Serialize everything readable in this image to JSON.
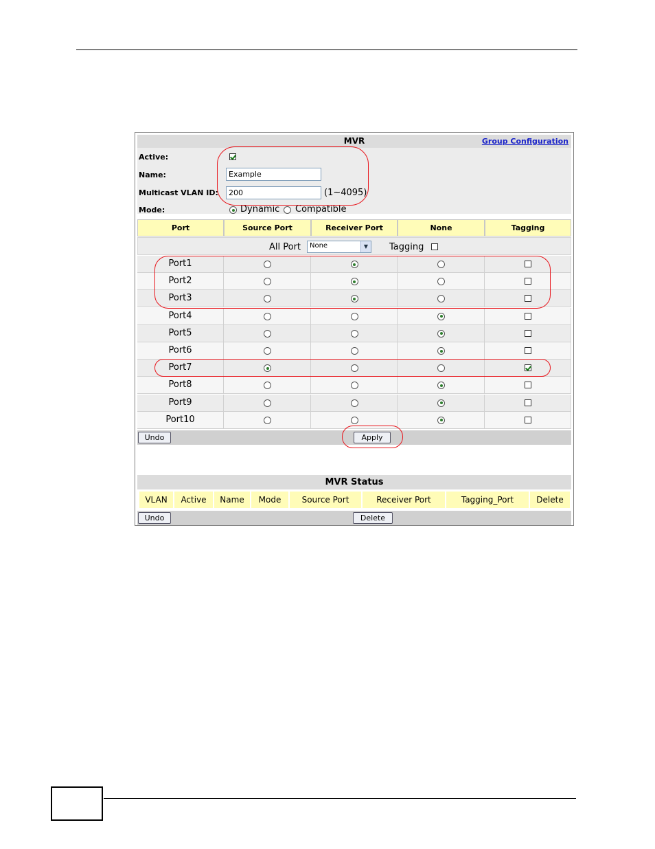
{
  "mvr": {
    "title": "MVR",
    "group_link": "Group Configuration",
    "active_label": "Active:",
    "active_checked": true,
    "name_label": "Name:",
    "name_value": "Example",
    "vlan_label": "Multicast VLAN ID:",
    "vlan_value": "200",
    "vlan_range": "(1~4095)",
    "mode_label": "Mode:",
    "mode_options": [
      "Dynamic",
      "Compatible"
    ],
    "mode_selected": "Dynamic"
  },
  "columns": [
    "Port",
    "Source Port",
    "Receiver Port",
    "None",
    "Tagging"
  ],
  "all_port": {
    "label": "All Port",
    "select_value": "None",
    "tagging_label": "Tagging",
    "tagging_checked": false
  },
  "ports": [
    {
      "name": "Port1",
      "role": "receiver",
      "tagging": false
    },
    {
      "name": "Port2",
      "role": "receiver",
      "tagging": false
    },
    {
      "name": "Port3",
      "role": "receiver",
      "tagging": false
    },
    {
      "name": "Port4",
      "role": "none",
      "tagging": false
    },
    {
      "name": "Port5",
      "role": "none",
      "tagging": false
    },
    {
      "name": "Port6",
      "role": "none",
      "tagging": false
    },
    {
      "name": "Port7",
      "role": "source",
      "tagging": true
    },
    {
      "name": "Port8",
      "role": "none",
      "tagging": false
    },
    {
      "name": "Port9",
      "role": "none",
      "tagging": false
    },
    {
      "name": "Port10",
      "role": "none",
      "tagging": false
    }
  ],
  "buttons": {
    "undo": "Undo",
    "apply": "Apply",
    "delete": "Delete"
  },
  "status": {
    "title": "MVR Status",
    "columns": [
      "VLAN",
      "Active",
      "Name",
      "Mode",
      "Source Port",
      "Receiver Port",
      "Tagging_Port",
      "Delete"
    ]
  },
  "colors": {
    "header_yellow": "#fffcb8",
    "link_blue": "#1a23c9",
    "highlight_red": "#e8141b"
  }
}
